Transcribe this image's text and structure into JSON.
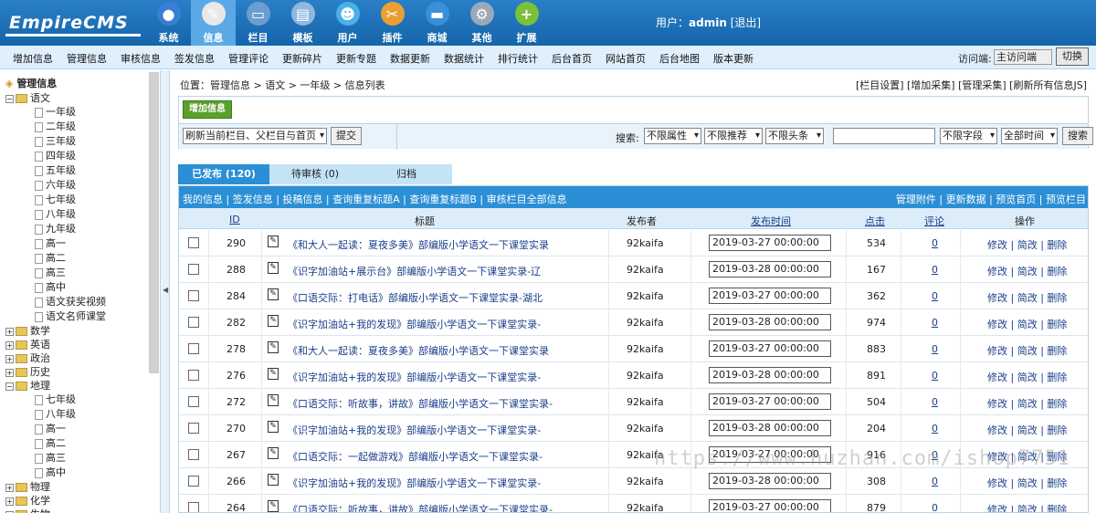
{
  "header": {
    "logo": "EmpireCMS",
    "nav": [
      {
        "label": "系统",
        "icon": "globe-icon",
        "glyph": "●",
        "color": "#3a7fd4"
      },
      {
        "label": "信息",
        "icon": "edit-icon",
        "glyph": "✎",
        "color": "#e8e8e8"
      },
      {
        "label": "栏目",
        "icon": "folder-icon",
        "glyph": "▭",
        "color": "#6a9ecf"
      },
      {
        "label": "模板",
        "icon": "template-icon",
        "glyph": "▤",
        "color": "#8fb8e0"
      },
      {
        "label": "用户",
        "icon": "user-icon",
        "glyph": "☻",
        "color": "#4cb0e8"
      },
      {
        "label": "插件",
        "icon": "tools-icon",
        "glyph": "✂",
        "color": "#e8a030"
      },
      {
        "label": "商城",
        "icon": "card-icon",
        "glyph": "▬",
        "color": "#3a90d8"
      },
      {
        "label": "其他",
        "icon": "gear-icon",
        "glyph": "⚙",
        "color": "#9aa8b8"
      },
      {
        "label": "扩展",
        "icon": "plus-icon",
        "glyph": "+",
        "color": "#7ac038"
      }
    ],
    "user_label": "用户：",
    "user_name": "admin",
    "logout": "[退出]"
  },
  "subnav": {
    "items": [
      "增加信息",
      "管理信息",
      "审核信息",
      "签发信息",
      "管理评论",
      "更新碎片",
      "更新专题",
      "数据更新",
      "数据统计",
      "排行统计",
      "后台首页",
      "网站首页",
      "后台地图",
      "版本更新"
    ],
    "visit_label": "访问端:",
    "visit_value": "主访问端",
    "switch": "切换"
  },
  "sidebar": {
    "title": "管理信息",
    "tree": [
      {
        "label": "语文",
        "type": "folder",
        "expanded": true
      },
      {
        "label": "一年级",
        "type": "doc"
      },
      {
        "label": "二年级",
        "type": "doc"
      },
      {
        "label": "三年级",
        "type": "doc"
      },
      {
        "label": "四年级",
        "type": "doc"
      },
      {
        "label": "五年级",
        "type": "doc"
      },
      {
        "label": "六年级",
        "type": "doc"
      },
      {
        "label": "七年级",
        "type": "doc"
      },
      {
        "label": "八年级",
        "type": "doc"
      },
      {
        "label": "九年级",
        "type": "doc"
      },
      {
        "label": "高一",
        "type": "doc"
      },
      {
        "label": "高二",
        "type": "doc"
      },
      {
        "label": "高三",
        "type": "doc"
      },
      {
        "label": "高中",
        "type": "doc"
      },
      {
        "label": "语文获奖视频",
        "type": "doc"
      },
      {
        "label": "语文名师课堂",
        "type": "doc"
      },
      {
        "label": "数学",
        "type": "folder",
        "expanded": false
      },
      {
        "label": "英语",
        "type": "folder",
        "expanded": false
      },
      {
        "label": "政治",
        "type": "folder",
        "expanded": false
      },
      {
        "label": "历史",
        "type": "folder",
        "expanded": false
      },
      {
        "label": "地理",
        "type": "folder",
        "expanded": true
      },
      {
        "label": "七年级",
        "type": "doc"
      },
      {
        "label": "八年级",
        "type": "doc"
      },
      {
        "label": "高一",
        "type": "doc"
      },
      {
        "label": "高二",
        "type": "doc"
      },
      {
        "label": "高三",
        "type": "doc"
      },
      {
        "label": "高中",
        "type": "doc"
      },
      {
        "label": "物理",
        "type": "folder",
        "expanded": false
      },
      {
        "label": "化学",
        "type": "folder",
        "expanded": false
      },
      {
        "label": "生物",
        "type": "folder",
        "expanded": false
      }
    ]
  },
  "content": {
    "breadcrumb": "位置：管理信息 > 语文 > 一年级 > 信息列表",
    "top_links": "[栏目设置] [增加采集] [管理采集] [刷新所有信息JS]",
    "add_button": "增加信息",
    "refresh_select": "刷新当前栏目、父栏目与首页",
    "submit": "提交",
    "search_label": "搜索:",
    "filters": [
      "不限属性",
      "不限推荐",
      "不限头条"
    ],
    "field_select": "不限字段",
    "time_select": "全部时间",
    "search_button": "搜索",
    "tabs": [
      "已发布 (120)",
      "待审核 (0)",
      "归档"
    ],
    "toolbar_left": "我的信息 | 签发信息 | 投稿信息 | 查询重复标题A | 查询重复标题B | 审核栏目全部信息",
    "toolbar_right": "管理附件 | 更新数据 | 预览首页 | 预览栏目",
    "columns": {
      "id": "ID",
      "title": "标题",
      "publisher": "发布者",
      "time": "发布时间",
      "clicks": "点击",
      "comments": "评论",
      "actions": "操作"
    },
    "action_links": "修改 | 简改 | 删除",
    "rows": [
      {
        "id": "290",
        "title": "《和大人一起读：夏夜多美》部编版小学语文一下课堂实录",
        "publisher": "92kaifa",
        "time": "2019-03-27 00:00:00",
        "clicks": "534",
        "comments": "0"
      },
      {
        "id": "288",
        "title": "《识字加油站+展示台》部编版小学语文一下课堂实录-辽",
        "publisher": "92kaifa",
        "time": "2019-03-28 00:00:00",
        "clicks": "167",
        "comments": "0"
      },
      {
        "id": "284",
        "title": "《口语交际：打电话》部编版小学语文一下课堂实录-湖北",
        "publisher": "92kaifa",
        "time": "2019-03-27 00:00:00",
        "clicks": "362",
        "comments": "0"
      },
      {
        "id": "282",
        "title": "《识字加油站+我的发现》部编版小学语文一下课堂实录-",
        "publisher": "92kaifa",
        "time": "2019-03-28 00:00:00",
        "clicks": "974",
        "comments": "0"
      },
      {
        "id": "278",
        "title": "《和大人一起读：夏夜多美》部编版小学语文一下课堂实录",
        "publisher": "92kaifa",
        "time": "2019-03-27 00:00:00",
        "clicks": "883",
        "comments": "0"
      },
      {
        "id": "276",
        "title": "《识字加油站+我的发现》部编版小学语文一下课堂实录-",
        "publisher": "92kaifa",
        "time": "2019-03-28 00:00:00",
        "clicks": "891",
        "comments": "0"
      },
      {
        "id": "272",
        "title": "《口语交际：听故事，讲故》部编版小学语文一下课堂实录-",
        "publisher": "92kaifa",
        "time": "2019-03-27 00:00:00",
        "clicks": "504",
        "comments": "0"
      },
      {
        "id": "270",
        "title": "《识字加油站+我的发现》部编版小学语文一下课堂实录-",
        "publisher": "92kaifa",
        "time": "2019-03-28 00:00:00",
        "clicks": "204",
        "comments": "0"
      },
      {
        "id": "267",
        "title": "《口语交际：一起做游戏》部编版小学语文一下课堂实录-",
        "publisher": "92kaifa",
        "time": "2019-03-27 00:00:00",
        "clicks": "916",
        "comments": "0"
      },
      {
        "id": "266",
        "title": "《识字加油站+我的发现》部编版小学语文一下课堂实录-",
        "publisher": "92kaifa",
        "time": "2019-03-28 00:00:00",
        "clicks": "308",
        "comments": "0"
      },
      {
        "id": "264",
        "title": "《口语交际：听故事，讲故》部编版小学语文一下课堂实录-",
        "publisher": "92kaifa",
        "time": "2019-03-27 00:00:00",
        "clicks": "879",
        "comments": "0"
      }
    ]
  },
  "watermark": "https://www.huzhan.com/ishop7751"
}
